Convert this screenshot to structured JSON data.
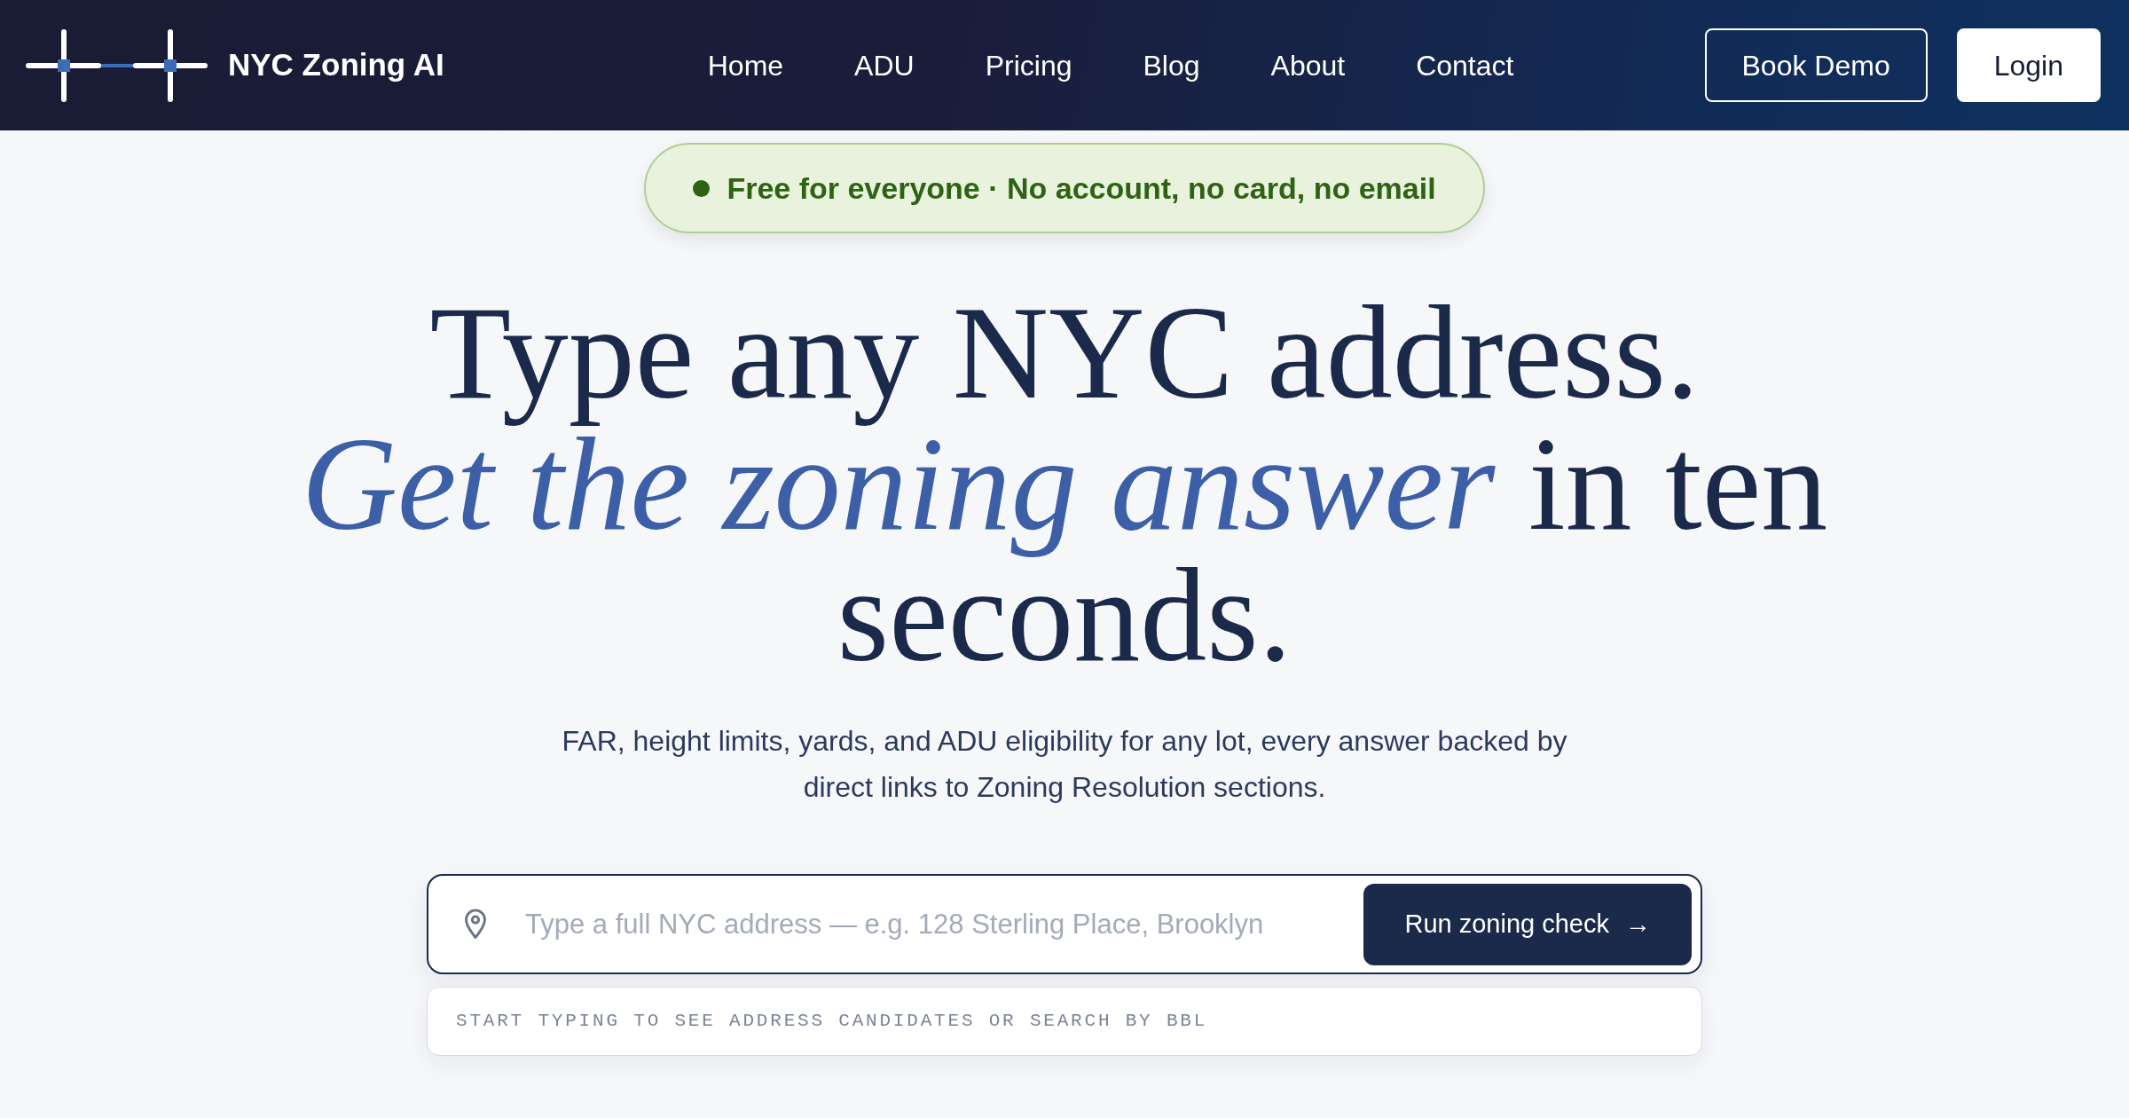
{
  "navbar": {
    "logo_text": "NYC Zoning AI",
    "links": [
      {
        "label": "Home"
      },
      {
        "label": "ADU"
      },
      {
        "label": "Pricing"
      },
      {
        "label": "Blog"
      },
      {
        "label": "About"
      },
      {
        "label": "Contact"
      }
    ],
    "buttons": [
      {
        "label": "Book Demo",
        "kind": "outline"
      },
      {
        "label": "Login",
        "kind": "solid"
      }
    ]
  },
  "badge": {
    "text": "Free for everyone · No account, no card, no email"
  },
  "hero": {
    "headline": [
      "Type any NYC address.",
      "*Get the zoning answer* in ten seconds."
    ],
    "subtitle": "FAR, height limits, yards, and ADU eligibility for any lot, every answer backed by direct links to Zoning Resolution sections."
  },
  "search": {
    "placeholder": "Type a full NYC address — e.g. 128 Sterling Place, Brooklyn",
    "button": "Run zoning check",
    "button_icon": "→",
    "hint": "START TYPING TO SEE ADDRESS CANDIDATES OR SEARCH BY BBL"
  }
}
